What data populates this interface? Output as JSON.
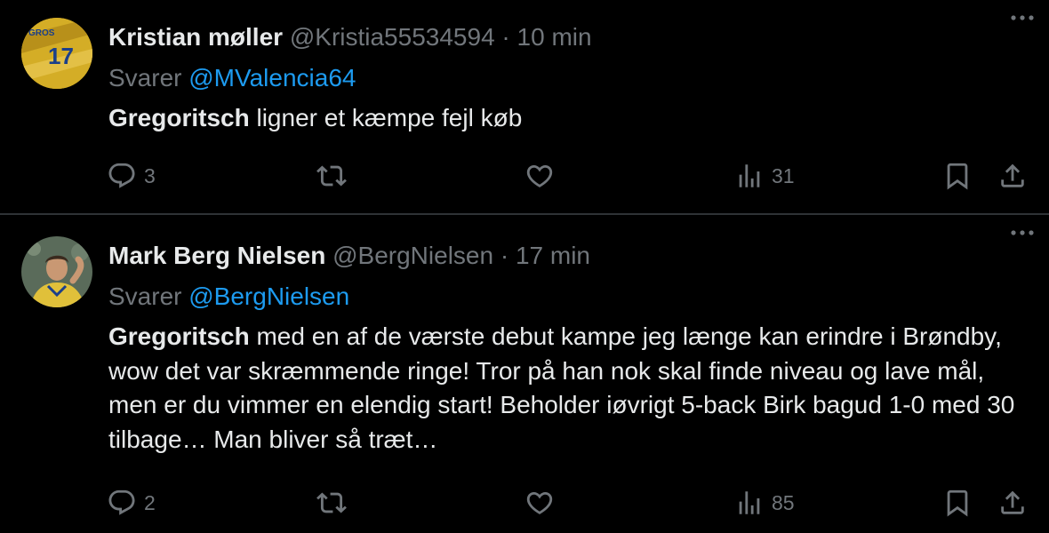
{
  "tweets": [
    {
      "name": "Kristian møller",
      "handle": "@Kristia55534594",
      "separator": "·",
      "time": "10 min",
      "reply_prefix": "Svarer",
      "reply_to": "@MValencia64",
      "body_bold": "Gregoritsch",
      "body_rest": " ligner et kæmpe fejl køb",
      "replies": "3",
      "retweets": "",
      "likes": "",
      "views": "31",
      "avatar_icon": "avatar-yellow-jersey"
    },
    {
      "name": "Mark Berg Nielsen",
      "handle": "@BergNielsen",
      "separator": "·",
      "time": "17 min",
      "reply_prefix": "Svarer",
      "reply_to": "@BergNielsen",
      "body_bold": "Gregoritsch",
      "body_rest": " med en af de værste debut kampe jeg længe kan erindre i Brøndby, wow det var skræmmende ringe! Tror på han nok skal finde niveau og lave mål, men er du vimmer en elendig start! Beholder iøvrigt 5-back Birk bagud 1-0 med 30 tilbage… Man bliver så træt…",
      "replies": "2",
      "retweets": "",
      "likes": "",
      "views": "85",
      "avatar_icon": "avatar-player-photo"
    }
  ],
  "icons": {
    "reply": "reply-icon",
    "retweet": "retweet-icon",
    "like": "like-icon",
    "views": "views-icon",
    "bookmark": "bookmark-icon",
    "share": "share-icon",
    "more": "more-icon"
  },
  "colors": {
    "background": "#000000",
    "text_primary": "#e7e9ea",
    "text_secondary": "#71767b",
    "link": "#1d9bf0",
    "divider": "#2f3336"
  }
}
